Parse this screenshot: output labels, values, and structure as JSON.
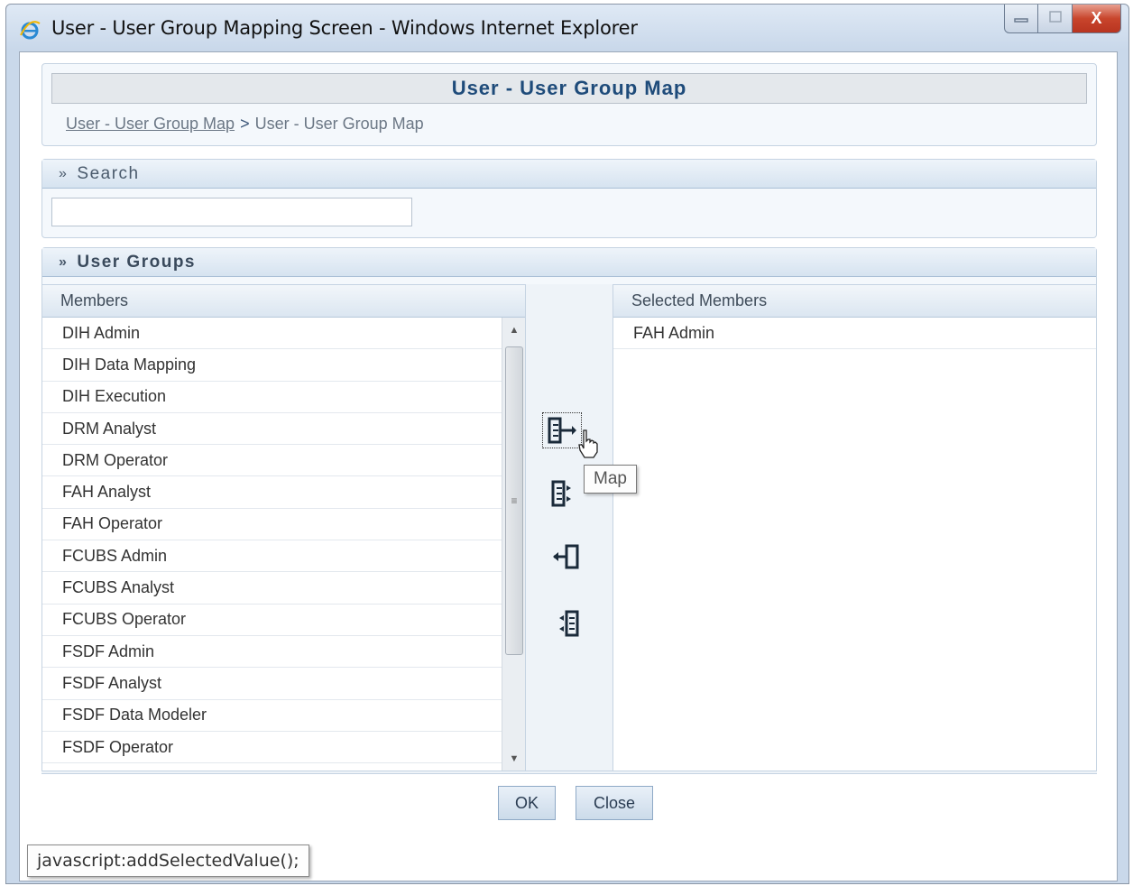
{
  "window": {
    "title": "User - User Group Mapping Screen - Windows Internet Explorer",
    "minimize_icon": "minimize-icon",
    "maximize_icon": "maximize-icon",
    "close_icon": "close-icon",
    "close_glyph": "X"
  },
  "header": {
    "title": "User - User Group Map",
    "breadcrumb": {
      "link": "User - User Group Map",
      "separator": ">",
      "current": "User - User Group Map"
    }
  },
  "search": {
    "section_label": "Search",
    "input_value": "",
    "chevron": "»"
  },
  "user_groups": {
    "section_label": "User Groups",
    "chevron": "»",
    "members_header": "Members",
    "selected_header": "Selected Members",
    "members": [
      "DIH Admin",
      "DIH Data Mapping",
      "DIH Execution",
      "DRM Analyst",
      "DRM Operator",
      "FAH Analyst",
      "FAH Operator",
      "FCUBS Admin",
      "FCUBS Analyst",
      "FCUBS Operator",
      "FSDF Admin",
      "FSDF Analyst",
      "FSDF Data Modeler",
      "FSDF Operator"
    ],
    "selected_members": [
      "FAH Admin"
    ],
    "tooltip": "Map"
  },
  "actions": {
    "ok_label": "OK",
    "close_label": "Close"
  },
  "status_bar": {
    "link_text": "javascript:addSelectedValue();"
  },
  "colors": {
    "title_text": "#1e4b7a",
    "section_border": "#c5d3e2",
    "button_gradient_top": "#e9f0f8",
    "button_gradient_bottom": "#ccdbea"
  }
}
